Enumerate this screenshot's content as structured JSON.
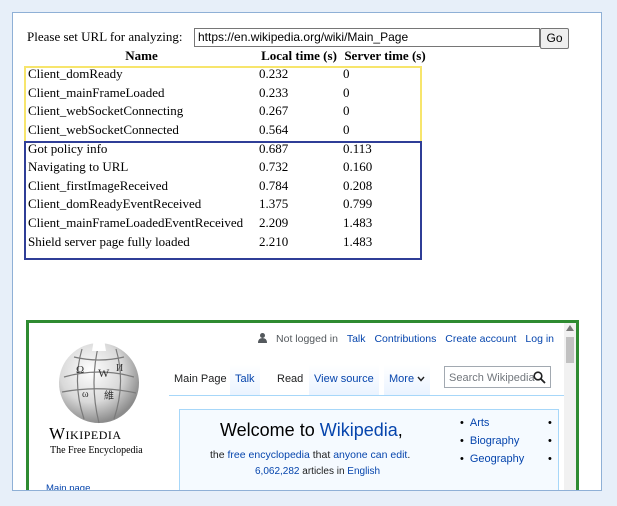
{
  "url_bar": {
    "label": "Please set URL for analyzing:",
    "value": "https://en.wikipedia.org/wiki/Main_Page",
    "go_label": "Go"
  },
  "table": {
    "headers": [
      "Name",
      "Local time (s)",
      "Server time (s)"
    ],
    "rows": [
      [
        "Client_domReady",
        "0.232",
        "0"
      ],
      [
        "Client_mainFrameLoaded",
        "0.233",
        "0"
      ],
      [
        "Client_webSocketConnecting",
        "0.267",
        "0"
      ],
      [
        "Client_webSocketConnected",
        "0.564",
        "0"
      ],
      [
        "Got policy info",
        "0.687",
        "0.113"
      ],
      [
        "Navigating to URL",
        "0.732",
        "0.160"
      ],
      [
        "Client_firstImageReceived",
        "0.784",
        "0.208"
      ],
      [
        "Client_domReadyEventReceived",
        "1.375",
        "0.799"
      ],
      [
        "Client_mainFrameLoadedEventReceived",
        "2.209",
        "1.483"
      ],
      [
        "Shield server page fully loaded",
        "2.210",
        "1.483"
      ]
    ]
  },
  "colors": {
    "client_group_border": "#f7e56c",
    "server_group_border": "#2f3e97",
    "preview_border": "#2e8b31"
  },
  "wiki": {
    "user_links": {
      "not_logged_in": "Not logged in",
      "talk": "Talk",
      "contributions": "Contributions",
      "create_account": "Create account",
      "log_in": "Log in"
    },
    "wordmark": "Wikipedia",
    "tagline": "The Free Encyclopedia",
    "sidebar_main_page": "Main page",
    "tabs": {
      "main_page": "Main Page",
      "talk": "Talk",
      "read": "Read",
      "view_source": "View source",
      "more": "More"
    },
    "search_placeholder": "Search Wikipedia",
    "welcome_prefix": "Welcome to ",
    "welcome_link": "Wikipedia",
    "welcome_suffix": ",",
    "sub_line": {
      "the": "the ",
      "free_encyclopedia": "free encyclopedia",
      "that": " that ",
      "anyone_can_edit": "anyone can edit",
      "period": "."
    },
    "articles_count": "6,062,282",
    "articles_in": " articles in ",
    "language": "English",
    "portals": [
      "Arts",
      "Biography",
      "Geography"
    ]
  }
}
